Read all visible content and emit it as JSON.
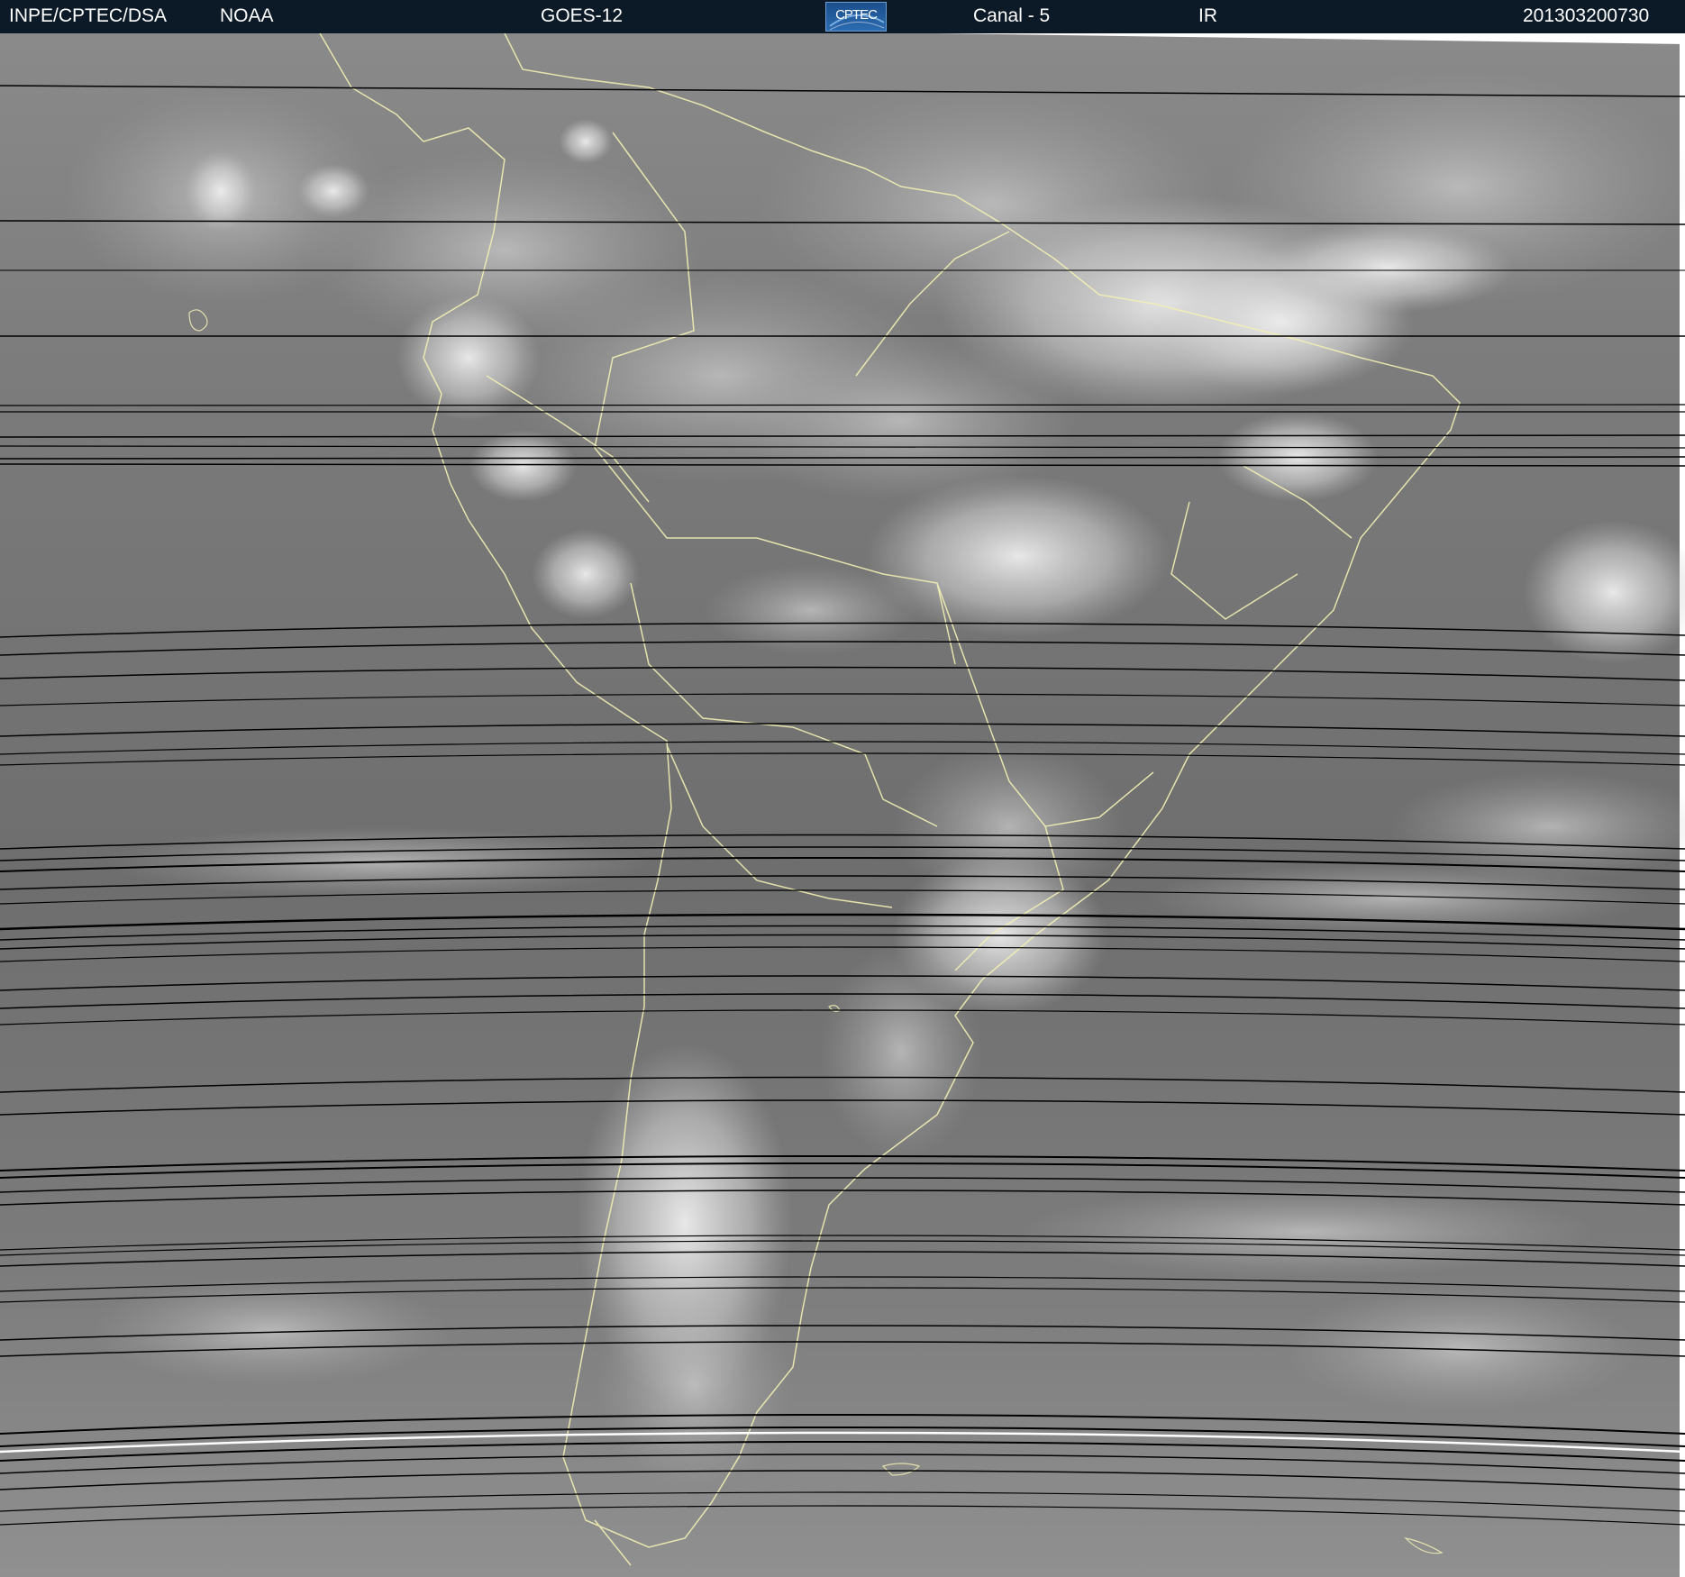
{
  "header": {
    "institution": "INPE/CPTEC/DSA",
    "agency": "NOAA",
    "satellite": "GOES-12",
    "logo_text": "CPTEC",
    "channel": "Canal - 5",
    "band": "IR",
    "timestamp": "201303200730"
  },
  "colors": {
    "header_background": "#0c1a28",
    "header_text": "#ffffff",
    "coastline": "#f2f0b4",
    "ocean_gray": "#6f6f6f",
    "cloud_white": "#efefef",
    "scan_line": "#000000"
  },
  "image": {
    "description_icon": "satellite-ir-image",
    "region_icon": "south-america-map"
  }
}
